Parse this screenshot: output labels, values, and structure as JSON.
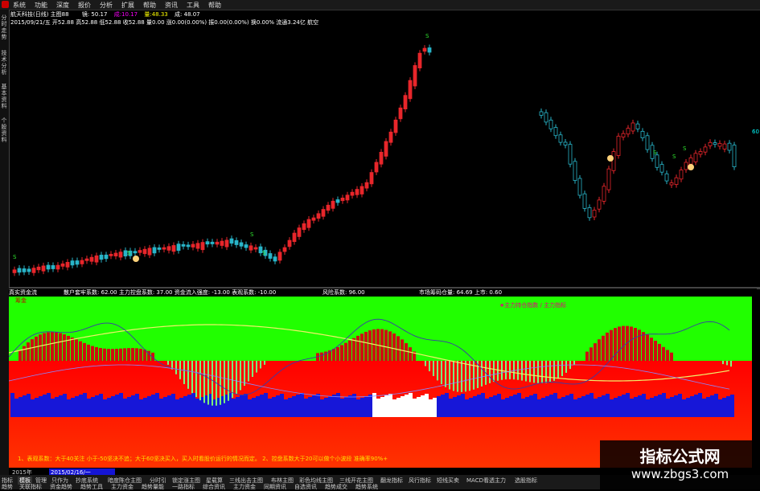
{
  "menu": [
    "系统",
    "功能",
    "深度",
    "报价",
    "分析",
    "扩展",
    "帮助",
    "资讯",
    "工具",
    "帮助"
  ],
  "info": {
    "row1": [
      {
        "text": "航天科技(日线) 主图88",
        "color": "#ffffff"
      },
      {
        "text": "镜: 50.17",
        "color": "#ffffff"
      },
      {
        "text": "成:10.17",
        "color": "#ff00ff"
      },
      {
        "text": "量:48.33",
        "color": "#ffff00"
      },
      {
        "text": "成: 48.07",
        "color": "#ffffff"
      }
    ],
    "row2": "2015/09/21/五 开52.88 高52.88 低52.88 收52.88 量0.00 涨0.00(0.00%) 振0.00(0.00%) 换0.00% 流通3.24亿 航空"
  },
  "left_tabs": [
    "分时走势",
    "技术分析",
    "基本资料",
    "个股资料"
  ],
  "indicator_header": [
    {
      "text": "真实资金流",
      "color": "#ffffff"
    },
    {
      "text": "散户套牢系数: 62.00  主力控盘系数: 37.00  资金流入强度: -13.00  表观系数: -10.00",
      "color": "#ffffff"
    },
    {
      "text": "风险系数: 96.00",
      "color": "#ffffff"
    },
    {
      "text": "市场筹码仓量: 64.69  上市: 0.60",
      "color": "#ffffff"
    }
  ],
  "indicator_title": "筹金",
  "indicator_legend": "★主力持仓指数 / 主力指标",
  "notes": "1、表观系数：大于40关注  小于-50坚决不追；大于60坚决买入，买入时看股价运行的情况而定。      2、控盘系数大于20可以做个小波段  准确率90%+",
  "dates": [
    "2015年",
    "2015/02/16/一"
  ],
  "tabs": [
    "指标",
    "模板",
    "管理",
    "只作为",
    "抄底系统",
    "暗度陈仓主图",
    "分时引",
    "锁定涨主图",
    "星载算",
    "三线出击主图",
    "布林主图",
    "彩色均线主图",
    "三线开花主图",
    "翻龙指标",
    "风行指标",
    "短线买卖",
    "MACD看透主力",
    "选股指标"
  ],
  "tabs_row2": [
    "趋势",
    "关联指标",
    "资金趋势",
    "趋势工具",
    "主力资金",
    "趋势量能",
    "一路指标",
    "综合资讯",
    "主力资金",
    "同期资讯",
    "自选资讯",
    "趋势成交",
    "趋势系统"
  ],
  "watermark": {
    "title": "指标公式网",
    "url": "www.zbgs3.com"
  },
  "right_axis_label": "60",
  "colors": {
    "up": "#e8262b",
    "down": "#29b5c9",
    "green_bg": "#21ff00",
    "red_bg": "#ff1a00",
    "blue": "#1717d8"
  }
}
